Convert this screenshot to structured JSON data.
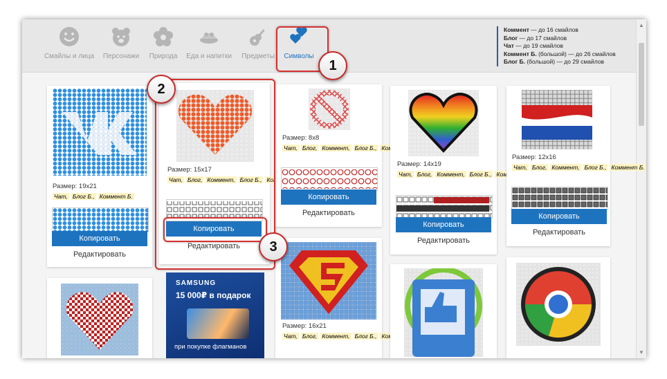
{
  "categories": [
    {
      "label": "Смайлы и лица",
      "icon": "smiley-icon",
      "active": false
    },
    {
      "label": "Персонажи",
      "icon": "bear-icon",
      "active": false
    },
    {
      "label": "Природа",
      "icon": "flower-icon",
      "active": false
    },
    {
      "label": "Еда и напитки",
      "icon": "food-icon",
      "active": false
    },
    {
      "label": "Предметы",
      "icon": "guitar-icon",
      "active": false
    },
    {
      "label": "Символы",
      "icon": "hearts-icon",
      "active": true
    }
  ],
  "limits": [
    {
      "name": "Коммент",
      "text": " — до 16 смайлов"
    },
    {
      "name": "Блог",
      "text": " — до 17 смайлов"
    },
    {
      "name": "Чат",
      "text": " — до 19 смайлов"
    },
    {
      "name": "Коммент Б.",
      "text": " (большой) — до 26 смайлов"
    },
    {
      "name": "Блог Б.",
      "text": " (большой) — до 29 смайлов"
    }
  ],
  "cards": [
    {
      "size": "Размер: 19x21",
      "tags": [
        "Чат,",
        "Блог Б.,",
        "Коммент Б."
      ],
      "copy": "Копировать",
      "edit": "Редактировать"
    },
    {
      "size": "Размер: 15x17",
      "tags": [
        "Чат,",
        "Блог,",
        "Коммент,",
        "Блог Б.,",
        "Коммент Б."
      ],
      "copy": "Копировать",
      "edit": "Редактировать"
    },
    {
      "size": "Размер: 8x8",
      "tags": [
        "Чат,",
        "Блог,",
        "Коммент,",
        "Блог Б.,",
        "Коммент Б."
      ],
      "copy": "Копировать",
      "edit": "Редактировать"
    },
    {
      "size": "Размер: 14x19",
      "tags": [
        "Чат,",
        "Блог,",
        "Коммент,",
        "Блог Б.,",
        "Коммент Б."
      ],
      "copy": "Копировать",
      "edit": "Редактировать"
    },
    {
      "size": "Размер: 12x16",
      "tags": [
        "Чат,",
        "Блог,",
        "Коммент,",
        "Блог Б.,",
        "Коммент Б."
      ],
      "copy": "Копировать",
      "edit": "Редактировать"
    },
    {
      "size": "Размер: 16x21",
      "tags": [
        "Чат,",
        "Блог,",
        "Коммент,",
        "Блог Б.,",
        "Коммент Б."
      ]
    }
  ],
  "ad": {
    "brand": "SAMSUNG",
    "headline": "15 000₽ в подарок",
    "footer": "при покупке флагманов"
  },
  "steps": [
    "1",
    "2",
    "3"
  ]
}
